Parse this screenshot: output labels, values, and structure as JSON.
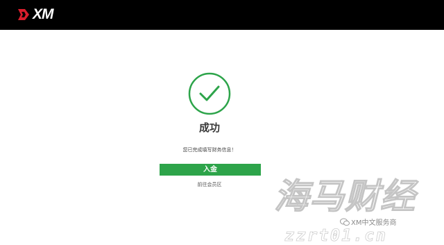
{
  "header": {
    "logo_text": "XM",
    "logo_icon": "xm-logo-mark"
  },
  "main": {
    "status_icon": "check-circle-icon",
    "title": "成功",
    "message": "您已完成填写财务信息！",
    "deposit_button_label": "入金",
    "member_area_link": "前往会员区"
  },
  "watermark": {
    "brand": "海马财经",
    "caption": "XM中文服务商",
    "url": "zzrt01.cn"
  },
  "colors": {
    "header_bg": "#000000",
    "accent_green": "#2da44a",
    "brand_red": "#d81e2c"
  }
}
